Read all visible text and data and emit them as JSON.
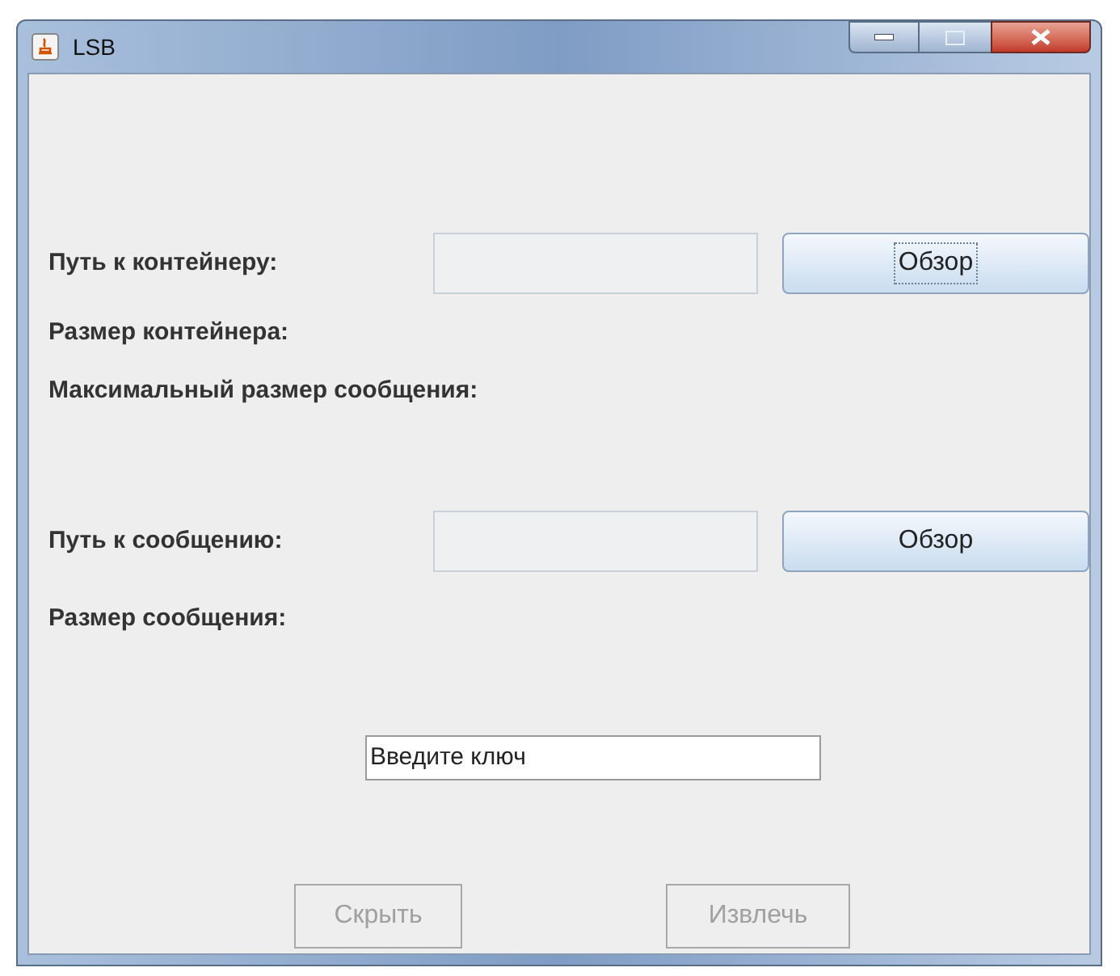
{
  "window": {
    "title": "LSB"
  },
  "container_row": {
    "label": "Путь к контейнеру:",
    "browse_button": {
      "label": "Обзор",
      "focused": true
    }
  },
  "container_size": {
    "label": "Размер контейнера:"
  },
  "max_message_size": {
    "label": "Максимальный размер сообщения:"
  },
  "message_row": {
    "label": "Путь к сообщению:",
    "browse_button": {
      "label": "Обзор",
      "focused": false
    }
  },
  "message_size": {
    "label": "Размер сообщения:"
  },
  "key_field": {
    "value": "Введите ключ"
  },
  "buttons": [
    {
      "label": "Скрыть",
      "disabled": true
    },
    {
      "label": "Извлечь",
      "disabled": true
    }
  ]
}
